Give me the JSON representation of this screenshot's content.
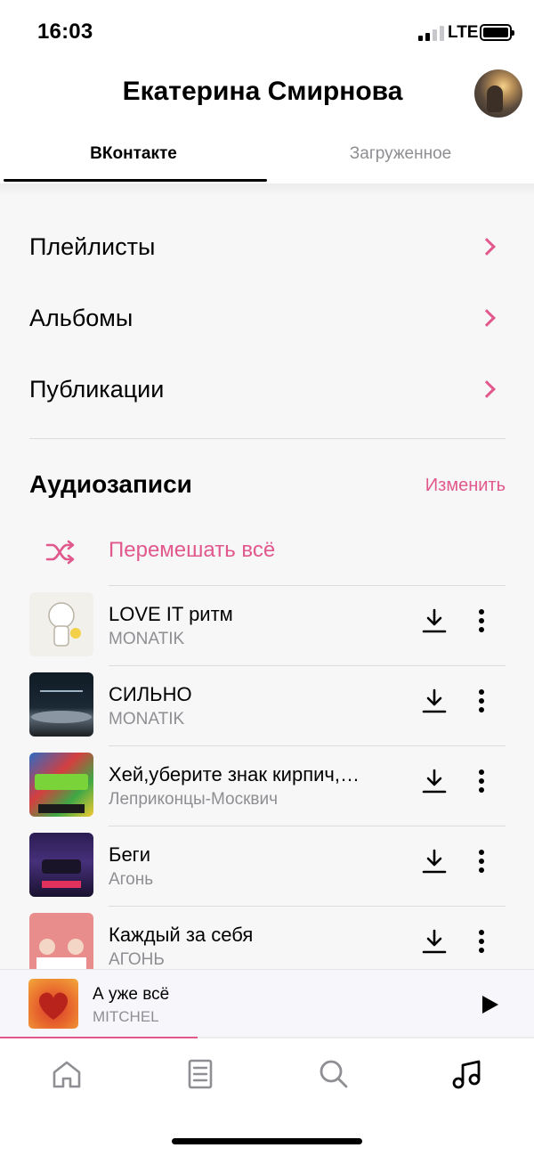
{
  "status_bar": {
    "time": "16:03",
    "network": "LTE",
    "signal_bars": 2,
    "signal_bars_total": 4,
    "battery_level": 1.0
  },
  "header": {
    "title": "Екатерина Смирнова"
  },
  "tabs": [
    {
      "label": "ВКонтакте",
      "active": true
    },
    {
      "label": "Загруженное",
      "active": false
    }
  ],
  "menu": [
    {
      "label": "Плейлисты"
    },
    {
      "label": "Альбомы"
    },
    {
      "label": "Публикации"
    }
  ],
  "audio": {
    "section_title": "Аудиозаписи",
    "edit_label": "Изменить",
    "shuffle_label": "Перемешать всё",
    "tracks": [
      {
        "title": "LOVE IT ритм",
        "artist": "MONATIK"
      },
      {
        "title": "СИЛЬНО",
        "artist": "MONATIK"
      },
      {
        "title": "Хей,уберите знак кирпич,…",
        "artist": "Леприконцы-Москвич"
      },
      {
        "title": "Беги",
        "artist": "Агонь"
      },
      {
        "title": "Каждый за себя",
        "artist": "АГОНЬ"
      }
    ]
  },
  "now_playing": {
    "title": "А уже всё",
    "artist": "MITCHEL",
    "progress": 0.37
  },
  "tabbar": {
    "items": [
      "home-icon",
      "news-icon",
      "search-icon",
      "music-icon"
    ],
    "active": "music-icon"
  },
  "colors": {
    "accent": "#e1588c",
    "secondary_text": "#8e8e93",
    "background": "#f7f7f7"
  }
}
